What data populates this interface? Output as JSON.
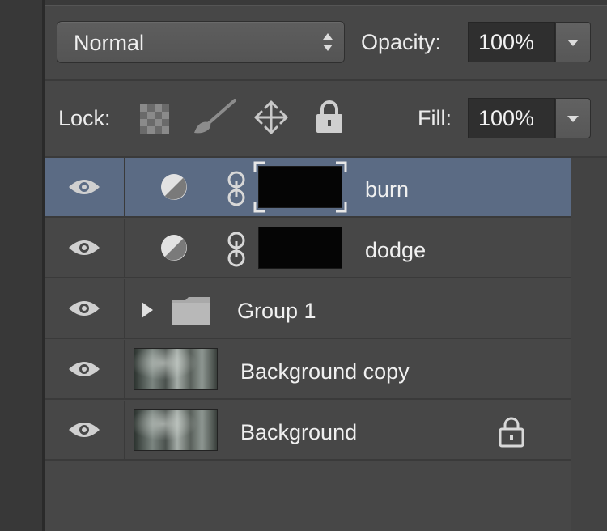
{
  "blend": {
    "mode": "Normal"
  },
  "opacity": {
    "label": "Opacity:",
    "value": "100%"
  },
  "lock": {
    "label": "Lock:"
  },
  "fill": {
    "label": "Fill:",
    "value": "100%"
  },
  "layers": [
    {
      "name": "burn",
      "selected": true,
      "type": "adjustment-with-mask"
    },
    {
      "name": "dodge",
      "selected": false,
      "type": "adjustment-with-mask"
    },
    {
      "name": "Group 1",
      "selected": false,
      "type": "group"
    },
    {
      "name": "Background copy",
      "selected": false,
      "type": "image"
    },
    {
      "name": "Background",
      "selected": false,
      "type": "image",
      "locked": true
    }
  ],
  "colors": {
    "panel": "#474747",
    "selected_row": "#5b6b84",
    "field": "#2f2f2f"
  }
}
